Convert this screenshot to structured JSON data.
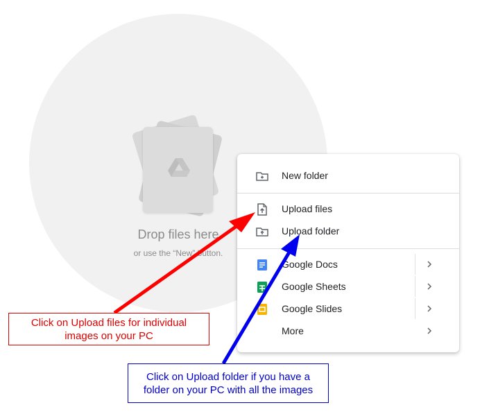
{
  "drop_area": {
    "title": "Drop files here",
    "subtitle": "or use the “New” button."
  },
  "menu": {
    "items": [
      {
        "label": "New folder",
        "icon": "new-folder-icon"
      },
      {
        "label": "Upload files",
        "icon": "upload-file-icon"
      },
      {
        "label": "Upload folder",
        "icon": "upload-folder-icon"
      },
      {
        "label": "Google Docs",
        "icon": "google-docs-icon",
        "has_submenu": true
      },
      {
        "label": "Google Sheets",
        "icon": "google-sheets-icon",
        "has_submenu": true
      },
      {
        "label": "Google Slides",
        "icon": "google-slides-icon",
        "has_submenu": true
      },
      {
        "label": "More",
        "has_submenu": true
      }
    ]
  },
  "annotations": {
    "red_note": "Click on Upload files for individual images on your PC",
    "blue_note": "Click on Upload folder if you have a folder on your PC with all the images"
  },
  "colors": {
    "docs": "#4285f4",
    "sheets": "#0f9d58",
    "slides": "#f4b400",
    "red_arrow": "#ff0000",
    "blue_arrow": "#0000ee"
  }
}
